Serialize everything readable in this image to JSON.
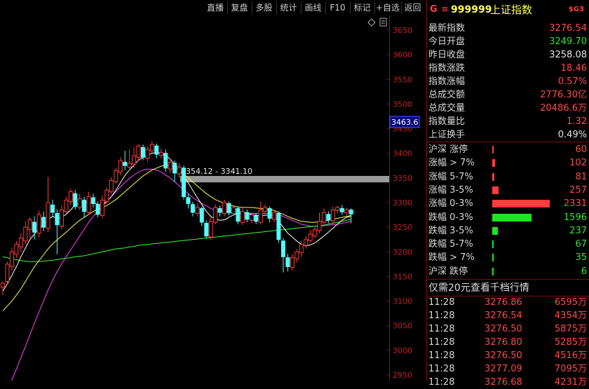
{
  "toolbar": {
    "buttons": [
      "直播",
      "复盘",
      "多股",
      "统计",
      "画线",
      "F10",
      "标记",
      "+自选",
      "返回"
    ]
  },
  "header": {
    "g_label": "G",
    "menu_glyph": "≡",
    "code": "999999",
    "name": "上证指数",
    "badge": "$G3"
  },
  "price_axis": [
    "3650",
    "3600",
    "3550",
    "3500",
    "3450",
    "3400",
    "3350",
    "3300",
    "3250",
    "3200",
    "3150",
    "3100",
    "3050",
    "3000",
    "2950"
  ],
  "current_price_tag": "3463.6",
  "range_band_label": "3354.12 - 3341.10",
  "chart_data": {
    "type": "candlestick",
    "title": "",
    "ylim": [
      2950,
      3660
    ],
    "range_band": [
      3341.1,
      3354.12
    ],
    "candles": [
      [
        3128,
        3136,
        3112,
        3140
      ],
      [
        3140,
        3175,
        3134,
        3180
      ],
      [
        3170,
        3200,
        3162,
        3208
      ],
      [
        3195,
        3215,
        3188,
        3222
      ],
      [
        3210,
        3228,
        3200,
        3238
      ],
      [
        3222,
        3250,
        3215,
        3262
      ],
      [
        3245,
        3265,
        3228,
        3270
      ],
      [
        3260,
        3240,
        3225,
        3272
      ],
      [
        3238,
        3276,
        3230,
        3284
      ],
      [
        3270,
        3250,
        3242,
        3282
      ],
      [
        3248,
        3300,
        3240,
        3352
      ],
      [
        3295,
        3280,
        3270,
        3306
      ],
      [
        3278,
        3255,
        3195,
        3286
      ],
      [
        3252,
        3285,
        3245,
        3295
      ],
      [
        3282,
        3305,
        3276,
        3312
      ],
      [
        3302,
        3322,
        3295,
        3328
      ],
      [
        3318,
        3292,
        3286,
        3326
      ],
      [
        3290,
        3308,
        3285,
        3318
      ],
      [
        3305,
        3282,
        3270,
        3312
      ],
      [
        3280,
        3312,
        3275,
        3322
      ],
      [
        3310,
        3298,
        3290,
        3318
      ],
      [
        3296,
        3276,
        3270,
        3302
      ],
      [
        3274,
        3305,
        3268,
        3314
      ],
      [
        3302,
        3325,
        3298,
        3330
      ],
      [
        3322,
        3345,
        3318,
        3352
      ],
      [
        3342,
        3365,
        3338,
        3370
      ],
      [
        3362,
        3385,
        3355,
        3392
      ],
      [
        3382,
        3375,
        3366,
        3405
      ],
      [
        3372,
        3380,
        3365,
        3408
      ],
      [
        3378,
        3395,
        3370,
        3412
      ],
      [
        3392,
        3415,
        3385,
        3418
      ],
      [
        3412,
        3392,
        3386,
        3418
      ],
      [
        3390,
        3408,
        3383,
        3414
      ],
      [
        3405,
        3418,
        3400,
        3425
      ],
      [
        3415,
        3398,
        3390,
        3420
      ],
      [
        3396,
        3402,
        3390,
        3410
      ],
      [
        3400,
        3370,
        3362,
        3408
      ],
      [
        3368,
        3382,
        3360,
        3390
      ],
      [
        3380,
        3360,
        3342,
        3386
      ],
      [
        3358,
        3372,
        3350,
        3380
      ],
      [
        3370,
        3312,
        3306,
        3375
      ],
      [
        3310,
        3298,
        3288,
        3318
      ],
      [
        3296,
        3280,
        3272,
        3302
      ],
      [
        3278,
        3290,
        3272,
        3298
      ],
      [
        3288,
        3260,
        3252,
        3292
      ],
      [
        3258,
        3232,
        3228,
        3264
      ],
      [
        3230,
        3262,
        3224,
        3270
      ],
      [
        3260,
        3290,
        3256,
        3296
      ],
      [
        3288,
        3280,
        3272,
        3294
      ],
      [
        3278,
        3300,
        3272,
        3306
      ],
      [
        3298,
        3280,
        3274,
        3302
      ],
      [
        3278,
        3290,
        3272,
        3295
      ],
      [
        3288,
        3262,
        3256,
        3292
      ],
      [
        3260,
        3282,
        3254,
        3290
      ],
      [
        3280,
        3266,
        3260,
        3286
      ],
      [
        3264,
        3275,
        3258,
        3280
      ],
      [
        3273,
        3262,
        3256,
        3278
      ],
      [
        3260,
        3285,
        3255,
        3302
      ],
      [
        3282,
        3290,
        3276,
        3296
      ],
      [
        3288,
        3268,
        3260,
        3292
      ],
      [
        3266,
        3280,
        3260,
        3284
      ],
      [
        3278,
        3225,
        3218,
        3282
      ],
      [
        3222,
        3190,
        3158,
        3228
      ],
      [
        3188,
        3170,
        3160,
        3196
      ],
      [
        3168,
        3188,
        3162,
        3195
      ],
      [
        3186,
        3200,
        3178,
        3206
      ],
      [
        3198,
        3215,
        3190,
        3222
      ],
      [
        3213,
        3225,
        3206,
        3232
      ],
      [
        3223,
        3236,
        3218,
        3244
      ],
      [
        3232,
        3245,
        3228,
        3250
      ],
      [
        3243,
        3262,
        3238,
        3280
      ],
      [
        3260,
        3280,
        3255,
        3288
      ],
      [
        3276,
        3265,
        3258,
        3282
      ],
      [
        3263,
        3285,
        3258,
        3292
      ],
      [
        3284,
        3290,
        3278,
        3294
      ],
      [
        3288,
        3281,
        3275,
        3295
      ],
      [
        3279,
        3285,
        3274,
        3290
      ],
      [
        3285,
        3276.54,
        3258,
        3288
      ]
    ],
    "ma_short": [
      3120,
      3135,
      3152,
      3170,
      3190,
      3208,
      3225,
      3236,
      3248,
      3255,
      3265,
      3272,
      3268,
      3270,
      3276,
      3285,
      3295,
      3300,
      3300,
      3302,
      3300,
      3296,
      3296,
      3302,
      3312,
      3325,
      3340,
      3355,
      3366,
      3376,
      3386,
      3392,
      3396,
      3400,
      3402,
      3400,
      3396,
      3388,
      3378,
      3368,
      3355,
      3340,
      3325,
      3310,
      3296,
      3282,
      3272,
      3266,
      3264,
      3265,
      3270,
      3275,
      3278,
      3280,
      3278,
      3276,
      3274,
      3274,
      3274,
      3275,
      3272,
      3262,
      3250,
      3238,
      3230,
      3222,
      3215,
      3212,
      3214,
      3218,
      3225,
      3232,
      3240,
      3248,
      3256,
      3264,
      3270,
      3272
    ],
    "ma_mid": [
      3080,
      3090,
      3100,
      3112,
      3125,
      3140,
      3155,
      3170,
      3182,
      3194,
      3206,
      3216,
      3224,
      3232,
      3240,
      3248,
      3256,
      3264,
      3270,
      3276,
      3282,
      3286,
      3290,
      3294,
      3300,
      3306,
      3314,
      3322,
      3330,
      3338,
      3346,
      3354,
      3360,
      3366,
      3370,
      3374,
      3376,
      3376,
      3372,
      3366,
      3358,
      3350,
      3342,
      3334,
      3326,
      3318,
      3312,
      3306,
      3302,
      3298,
      3295,
      3293,
      3291,
      3290,
      3290,
      3290,
      3289,
      3288,
      3287,
      3286,
      3284,
      3280,
      3276,
      3272,
      3268,
      3265,
      3262,
      3261,
      3260,
      3260,
      3261,
      3262,
      3264,
      3266,
      3268,
      3270,
      3272,
      3274
    ],
    "ma_long": [
      3190,
      3188,
      3186,
      3184,
      3182,
      3181,
      3180,
      3180,
      3180,
      3181,
      3182,
      3183,
      3184,
      3186,
      3187,
      3188,
      3190,
      3191,
      3192,
      3194,
      3196,
      3198,
      3200,
      3202,
      3204,
      3206,
      3207,
      3208,
      3210,
      3211,
      3213,
      3214,
      3215,
      3216,
      3217,
      3218,
      3219,
      3220,
      3221,
      3222,
      3223,
      3224,
      3225,
      3226,
      3227,
      3228,
      3229,
      3230,
      3231,
      3232,
      3233,
      3234,
      3235,
      3236,
      3237,
      3238,
      3239,
      3240,
      3241,
      3242,
      3243,
      3244,
      3245,
      3246,
      3247,
      3248,
      3249,
      3250,
      3251,
      3252,
      3253,
      3254,
      3256,
      3258,
      3260,
      3262,
      3264,
      3266
    ],
    "ma_extra": [
      2900,
      2920,
      2940,
      2962,
      2985,
      3008,
      3032,
      3055,
      3078,
      3100,
      3122,
      3142,
      3160,
      3176,
      3190,
      3204,
      3218,
      3232,
      3246,
      3260,
      3272,
      3282,
      3292,
      3302,
      3312,
      3322,
      3332,
      3341,
      3349,
      3356,
      3362,
      3366,
      3368,
      3368,
      3366,
      3362,
      3356,
      3350,
      3342,
      3334,
      3326,
      3318,
      3310,
      3304,
      3298,
      3293,
      3288,
      3284,
      3282,
      3280,
      3279,
      3278,
      3278,
      3278,
      3278,
      3278,
      3278,
      3278,
      3278,
      3278,
      3277,
      3275,
      3272,
      3268,
      3264,
      3260,
      3256,
      3254,
      3252,
      3252,
      3252,
      3253,
      3254,
      3255,
      3256,
      3258,
      3260,
      3262
    ]
  },
  "quote": {
    "rows": [
      {
        "label": "最新指数",
        "value": "3276.54",
        "color": "red"
      },
      {
        "label": "今日开盘",
        "value": "3249.70",
        "color": "green"
      },
      {
        "label": "昨日收盘",
        "value": "3258.08",
        "color": "white"
      },
      {
        "label": "指数涨跌",
        "value": "18.46",
        "color": "red"
      },
      {
        "label": "指数涨幅",
        "value": "0.57%",
        "color": "red"
      },
      {
        "label": "总成交额",
        "value": "2776.30亿",
        "color": "red"
      },
      {
        "label": "总成交量",
        "value": "20486.6万",
        "color": "red"
      },
      {
        "label": "指数量比",
        "value": "1.32",
        "color": "red"
      },
      {
        "label": "上证换手",
        "value": "0.49%",
        "color": "white"
      }
    ]
  },
  "breadth": {
    "rows": [
      {
        "label": "沪深 涨停",
        "value": "60",
        "color": "red",
        "fraction": 0.026
      },
      {
        "label": "涨幅 > 7%",
        "value": "102",
        "color": "red",
        "fraction": 0.044
      },
      {
        "label": "涨幅 5-7%",
        "value": "81",
        "color": "red",
        "fraction": 0.035
      },
      {
        "label": "涨幅 3-5%",
        "value": "257",
        "color": "red",
        "fraction": 0.111
      },
      {
        "label": "涨幅 0-3%",
        "value": "2331",
        "color": "red",
        "fraction": 1.0
      },
      {
        "label": "跌幅 0-3%",
        "value": "1596",
        "color": "green",
        "fraction": 0.685
      },
      {
        "label": "跌幅 3-5%",
        "value": "237",
        "color": "green",
        "fraction": 0.102
      },
      {
        "label": "跌幅 5-7%",
        "value": "67",
        "color": "green",
        "fraction": 0.029
      },
      {
        "label": "跌幅 > 7%",
        "value": "35",
        "color": "green",
        "fraction": 0.015
      },
      {
        "label": "沪深 跌停",
        "value": "6",
        "color": "green",
        "fraction": 0.003
      }
    ]
  },
  "promo": "仅需20元查看千档行情",
  "ticks": [
    {
      "time": "11:28",
      "price": "3276.86",
      "volume": "6595万"
    },
    {
      "time": "11:28",
      "price": "3276.54",
      "volume": "4354万"
    },
    {
      "time": "11:28",
      "price": "3276.50",
      "volume": "5875万"
    },
    {
      "time": "11:28",
      "price": "3276.80",
      "volume": "5285万"
    },
    {
      "time": "11:28",
      "price": "3276.50",
      "volume": "4516万"
    },
    {
      "time": "11:28",
      "price": "3277.09",
      "volume": "7095万"
    },
    {
      "time": "11:28",
      "price": "3276.68",
      "volume": "4231万"
    }
  ],
  "colors": {
    "up": "#ff3c3c",
    "down": "#54ffff",
    "ma_short": "#ffffff",
    "ma_mid": "#ffff44",
    "ma_long": "#33ff33",
    "ma_extra": "#ff44ff",
    "band": "#9a9a9a",
    "axis": "#a01010"
  }
}
